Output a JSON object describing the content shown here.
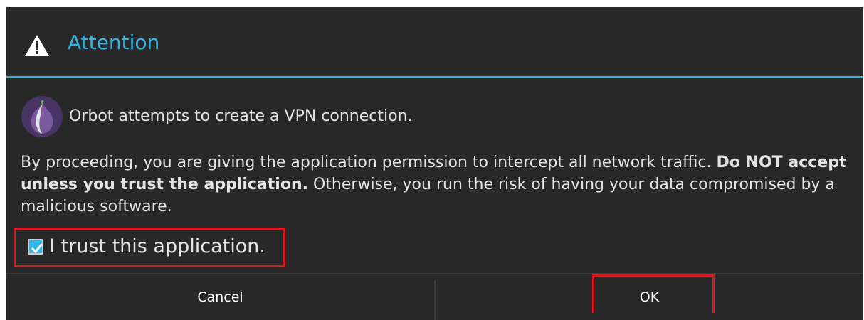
{
  "dialog": {
    "title": "Attention",
    "title_icon": "warning-icon",
    "app_icon": "orbot-onion-icon",
    "app_message": "Orbot attempts to create a VPN connection.",
    "body_text_1": "By proceeding, you are giving the application permission to intercept all network traffic.",
    "body_text_bold": "Do NOT accept unless you trust the application.",
    "body_text_2": "Otherwise, you run the risk of having your data compromised by a malicious software.",
    "trust_checkbox": {
      "label": "I trust this application.",
      "checked": true
    },
    "buttons": {
      "cancel_label": "Cancel",
      "ok_label": "OK"
    }
  },
  "colors": {
    "background": "#282828",
    "title_accent": "#33b5e5",
    "text": "#e4e4e4",
    "button_text": "#ffffff",
    "divider": "#3c3c3c",
    "checkbox_fill": "#33b5e5",
    "highlight_red": "#e0141c",
    "onion_purple": "#5a3a78"
  }
}
